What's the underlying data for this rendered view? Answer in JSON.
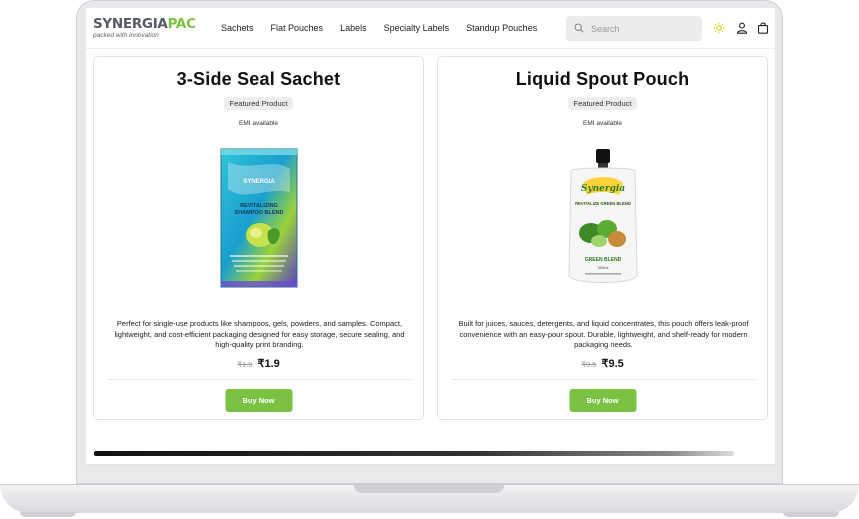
{
  "header": {
    "logo_main": "SYNERGIA",
    "logo_accent": "PAC",
    "logo_tagline": "packed with innovation",
    "nav": [
      "Sachets",
      "Flat Pouches",
      "Labels",
      "Specialty Labels",
      "Standup Pouches"
    ],
    "search_placeholder": "Search"
  },
  "icons": {
    "theme": "sun-icon",
    "account": "user-icon",
    "cart": "bag-icon"
  },
  "colors": {
    "accent": "#7cc242",
    "badge_bg": "#eeeeee"
  },
  "products": [
    {
      "title": "3-Side Seal Sachet",
      "badge": "Featured Product",
      "emi": "EMI available",
      "description": "Perfect for single-use products like shampoos, gels, powders, and samples. Compact, lightweight, and cost-efficient packaging designed for easy storage, secure sealing, and high-quality print branding.",
      "price_old": "₹1.9",
      "price_new": "₹1.9",
      "button": "Buy Now",
      "image_text": {
        "brand": "SYNERGIA",
        "line1": "REVITALIZING",
        "line2": "SHAMPOO BLEND"
      }
    },
    {
      "title": "Liquid Spout Pouch",
      "badge": "Featured Product",
      "emi": "EMI available",
      "description": "Built for juices, sauces, detergents, and liquid concentrates, this pouch offers leak-proof convenience with an easy-pour spout. Durable, lightweight, and shelf-ready for modern packaging needs.",
      "price_old": "₹9.5",
      "price_new": "₹9.5",
      "button": "Buy Now",
      "image_text": {
        "brand": "Synergia",
        "line1": "REVITALIZE GREEN BLEND",
        "line2": "GREEN BLEND",
        "line3": "300ml"
      }
    }
  ]
}
